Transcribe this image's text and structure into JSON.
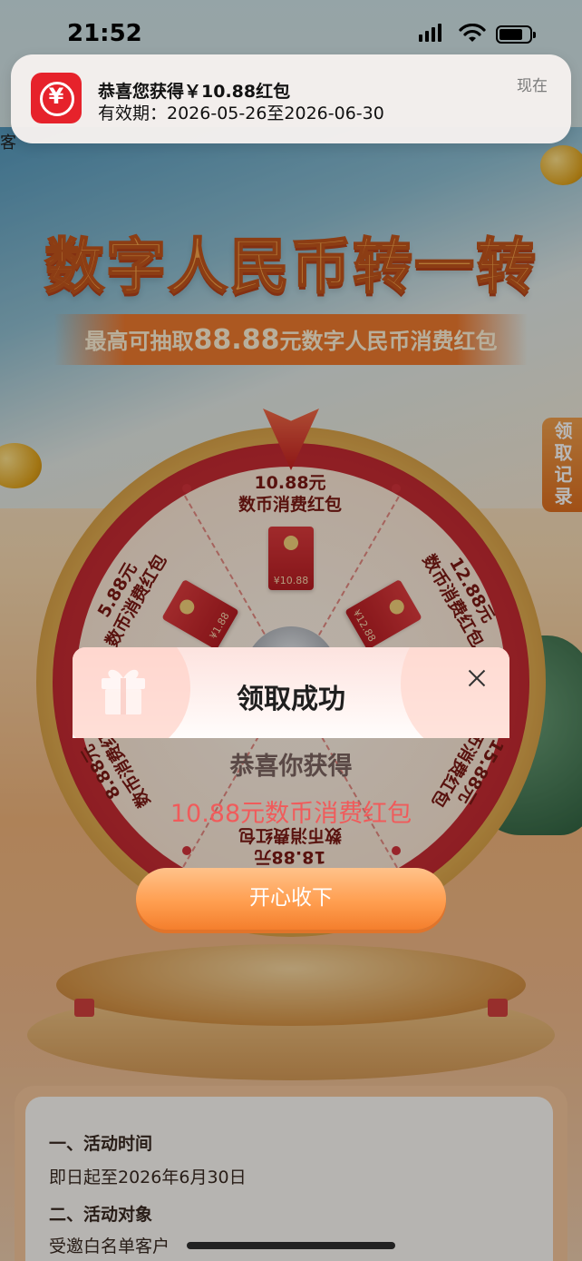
{
  "status_bar": {
    "time": "21:52"
  },
  "notification": {
    "icon": "digital-rmb-app-icon",
    "title": "恭喜您获得￥10.88红包",
    "body": "有效期：2026-05-26至2026-06-30",
    "time": "现在"
  },
  "page": {
    "peek_text": "客",
    "title": "数字人民币转一转",
    "subtitle_prefix": "最高可抽取",
    "subtitle_amount": "88.88",
    "subtitle_suffix": "元数字人民币消费红包",
    "side_tab": "领取记录"
  },
  "wheel": {
    "prizes": [
      {
        "label": "10.88元\n数币消费红包",
        "envelope": "¥10.88"
      },
      {
        "label": "12.88元\n数币消费红包",
        "envelope": "¥12.88"
      },
      {
        "label": "15.88元\n数币消费红包"
      },
      {
        "label": "18.88元\n数币消费红包"
      },
      {
        "label": "8.88元\n数币消费红包"
      },
      {
        "label": "5.88元\n数币消费红包",
        "envelope": "¥1.88"
      }
    ]
  },
  "rules": {
    "h1": "一、活动时间",
    "t1": "即日起至2026年6月30日",
    "h2": "二、活动对象",
    "t2": "受邀白名单客户"
  },
  "dialog": {
    "title": "领取成功",
    "congrats": "恭喜你获得",
    "prize": "10.88元数币消费红包",
    "accept": "开心收下"
  },
  "colors": {
    "accent": "#f47f2d",
    "prize_text": "#f05b5b",
    "brand_red": "#e6222b"
  }
}
